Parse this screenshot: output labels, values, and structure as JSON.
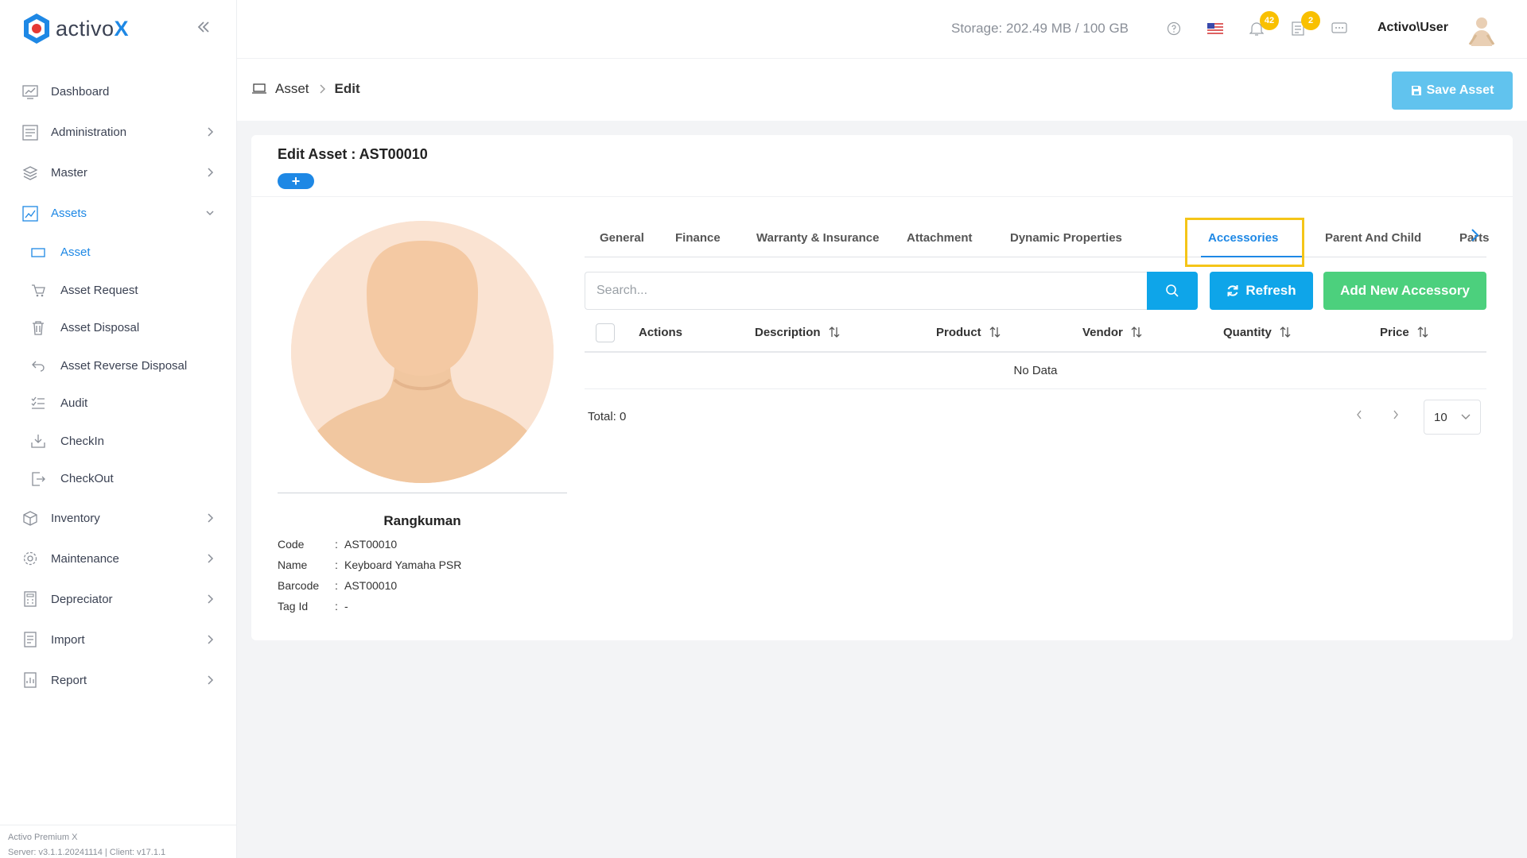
{
  "app": {
    "brand_prefix": "activo",
    "brand_suffix": "X",
    "accent": "#1e88e5"
  },
  "sidebar": {
    "items": [
      {
        "label": "Dashboard",
        "icon": "chart-icon"
      },
      {
        "label": "Administration",
        "icon": "list-icon"
      },
      {
        "label": "Master",
        "icon": "layers-icon"
      },
      {
        "label": "Assets",
        "icon": "asset-board-icon"
      },
      {
        "label": "Inventory",
        "icon": "box-icon"
      },
      {
        "label": "Maintenance",
        "icon": "gear-icon"
      },
      {
        "label": "Depreciator",
        "icon": "calculator-icon"
      },
      {
        "label": "Import",
        "icon": "import-icon"
      },
      {
        "label": "Report",
        "icon": "report-icon"
      }
    ],
    "asset_subitems": [
      {
        "label": "Asset",
        "icon": "laptop-icon"
      },
      {
        "label": "Asset Request",
        "icon": "cart-icon"
      },
      {
        "label": "Asset Disposal",
        "icon": "trash-icon"
      },
      {
        "label": "Asset Reverse Disposal",
        "icon": "undo-icon"
      },
      {
        "label": "Audit",
        "icon": "checklist-icon"
      },
      {
        "label": "CheckIn",
        "icon": "download-icon"
      },
      {
        "label": "CheckOut",
        "icon": "logout-icon"
      }
    ],
    "footer_line1": "Activo Premium X",
    "footer_line2": "Server: v3.1.1.20241114 | Client: v17.1.1"
  },
  "header": {
    "storage": "Storage: 202.49 MB / 100 GB",
    "notifications_count": "42",
    "tasks_count": "2",
    "user": "Activo\\User"
  },
  "breadcrumb": {
    "root": "Asset",
    "current": "Edit"
  },
  "toolbar": {
    "save_label": "Save Asset"
  },
  "card": {
    "title": "Edit Asset : AST00010",
    "plus_label": "+",
    "summary_title": "Rangkuman",
    "summary": [
      {
        "key": "Code",
        "value": "AST00010"
      },
      {
        "key": "Name",
        "value": "Keyboard Yamaha PSR"
      },
      {
        "key": "Barcode",
        "value": "AST00010"
      },
      {
        "key": "Tag Id",
        "value": "-"
      }
    ]
  },
  "tabs": [
    "General",
    "Finance",
    "Warranty & Insurance",
    "Attachment",
    "Dynamic Properties",
    "Accessories",
    "Parent And Child",
    "Parts"
  ],
  "active_tab": "Accessories",
  "accessories": {
    "search_placeholder": "Search...",
    "refresh_label": "Refresh",
    "add_label": "Add New Accessory",
    "columns": [
      "Actions",
      "Description",
      "Product",
      "Vendor",
      "Quantity",
      "Price"
    ],
    "empty_text": "No Data",
    "total": "Total: 0",
    "page_size": "10"
  }
}
